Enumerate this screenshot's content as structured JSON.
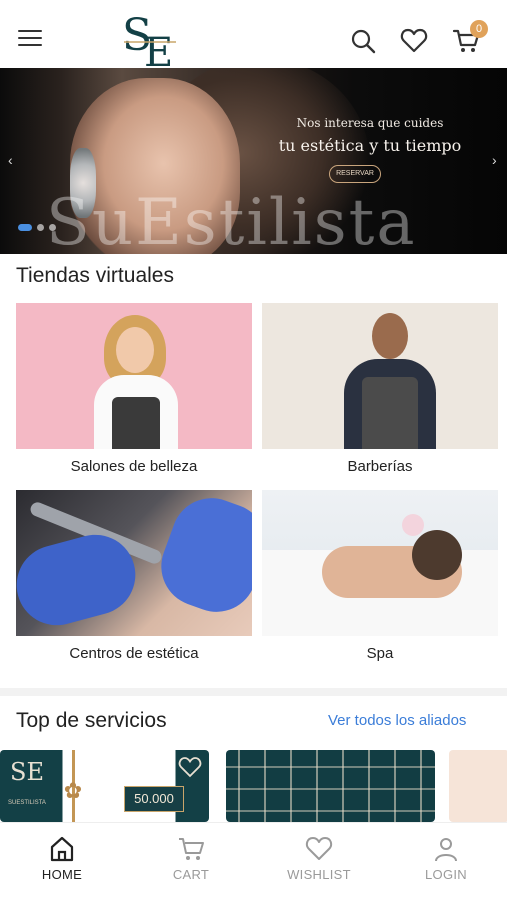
{
  "header": {
    "logo_text": "SE",
    "menu_icon": "hamburger-menu-icon",
    "search_icon": "search-icon",
    "wishlist_icon": "heart-icon",
    "cart_icon": "cart-icon",
    "cart_count": "0"
  },
  "banner": {
    "tagline": "Nos interesa que cuides",
    "headline": "tu estética y tu tiempo",
    "button_label": "RESERVAR",
    "watermark": "SuEstilista",
    "prev_arrow": "‹",
    "next_arrow": "›",
    "slides": 3,
    "active_slide": 1
  },
  "stores": {
    "title": "Tiendas virtuales",
    "items": [
      {
        "label": "Salones de belleza"
      },
      {
        "label": "Barberías"
      },
      {
        "label": "Centros de estética"
      },
      {
        "label": "Spa"
      }
    ]
  },
  "services": {
    "title": "Top de servicios",
    "see_all": "Ver todos los aliados",
    "cards": [
      {
        "logo": "SE",
        "brand": "SUESTILISTA",
        "price": "50.000"
      }
    ]
  },
  "bottom_nav": {
    "items": [
      {
        "label": "HOME",
        "icon": "home-icon",
        "active": true
      },
      {
        "label": "CART",
        "icon": "cart-icon",
        "active": false
      },
      {
        "label": "WISHLIST",
        "icon": "heart-icon",
        "active": false
      },
      {
        "label": "LOGIN",
        "icon": "user-icon",
        "active": false
      }
    ]
  },
  "colors": {
    "brand_teal": "#134046",
    "accent_gold": "#c9a56a",
    "badge": "#e0a25a",
    "link_blue": "#3b7dd8",
    "dot_active": "#4a8fe0"
  }
}
